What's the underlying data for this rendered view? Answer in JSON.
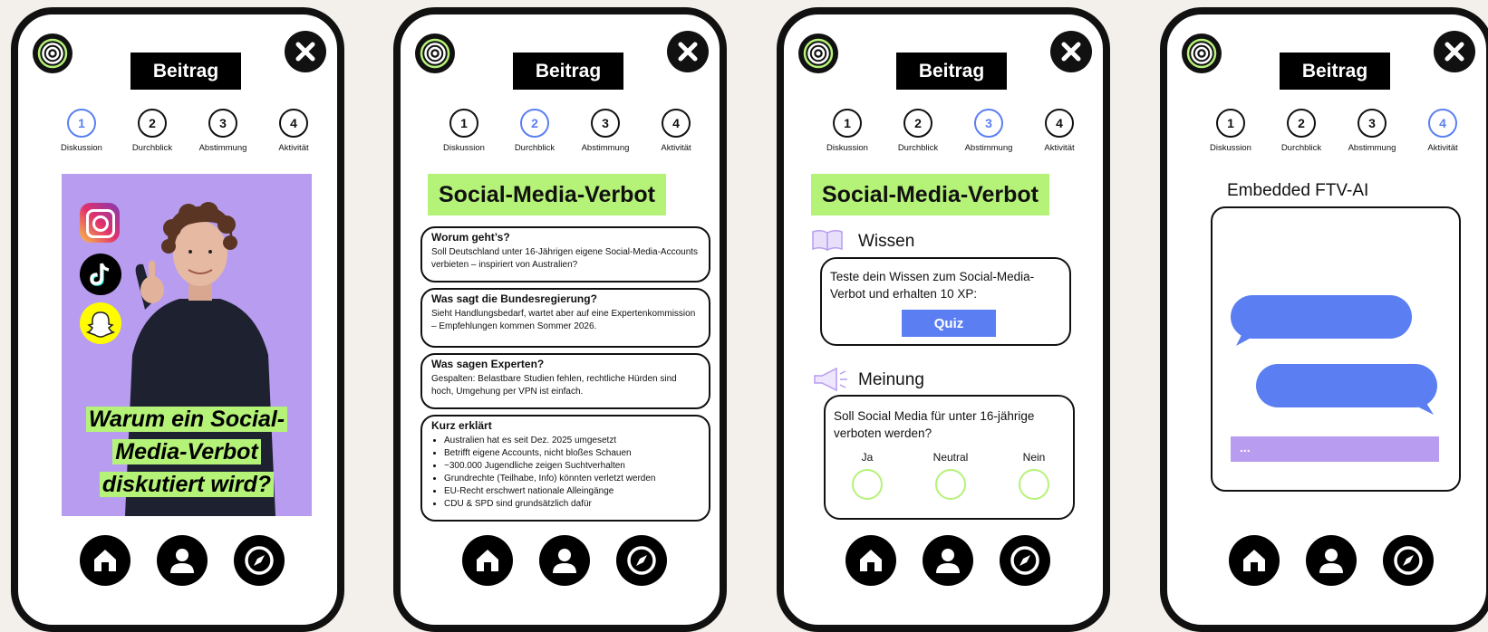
{
  "header": {
    "title": "Beitrag"
  },
  "steps": [
    {
      "num": "1",
      "label": "Diskussion"
    },
    {
      "num": "2",
      "label": "Durchblick"
    },
    {
      "num": "3",
      "label": "Abstimmung"
    },
    {
      "num": "4",
      "label": "Aktivität"
    }
  ],
  "colors": {
    "accent_blue": "#5b7ff2",
    "accent_green": "#b5f278",
    "accent_purple": "#b79cf0"
  },
  "icons": {
    "logo": "radio-signal-logo-icon",
    "close": "close-icon",
    "bottom_nav": [
      "home-icon",
      "user-icon",
      "compass-icon"
    ],
    "social": [
      "instagram-icon",
      "tiktok-icon",
      "snapchat-icon"
    ],
    "wissen": "book-icon",
    "meinung": "megaphone-icon"
  },
  "screen1": {
    "caption": [
      "Warum ein Social-",
      "Media-Verbot",
      "diskutiert wird?"
    ]
  },
  "screen2": {
    "heading": "Social-Media-Verbot",
    "cards": [
      {
        "title": "Worum geht’s?",
        "text": "Soll Deutschland unter 16-Jährigen eigene Social-Media-Accounts verbieten – inspiriert von Australien?"
      },
      {
        "title": "Was sagt die Bundesregierung?",
        "text": "Sieht Handlungsbedarf, wartet aber auf eine Expertenkommission – Empfehlungen kommen Sommer 2026."
      },
      {
        "title": "Was sagen Experten?",
        "text": "Gespalten: Belastbare Studien fehlen, rechtliche Hürden sind hoch, Umgehung per VPN ist einfach."
      }
    ],
    "summary": {
      "title": "Kurz erklärt",
      "items": [
        "Australien hat es seit Dez. 2025 umgesetzt",
        "Betrifft eigene Accounts, nicht bloßes Schauen",
        "~300.000 Jugendliche zeigen Suchtverhalten",
        "Grundrechte (Teilhabe, Info) könnten verletzt werden",
        "EU-Recht erschwert nationale Alleingänge",
        "CDU & SPD sind grundsätzlich dafür"
      ]
    }
  },
  "screen3": {
    "heading": "Social-Media-Verbot",
    "wissen_label": "Wissen",
    "quiz_text": "Teste dein Wissen zum Social-Media-Verbot und erhalten 10 XP:",
    "quiz_button": "Quiz",
    "meinung_label": "Meinung",
    "poll_question": "Soll Social Media für unter 16-jährige verboten werden?",
    "poll_options": [
      "Ja",
      "Neutral",
      "Nein"
    ]
  },
  "screen4": {
    "title": "Embedded FTV-AI",
    "input_placeholder": "..."
  }
}
